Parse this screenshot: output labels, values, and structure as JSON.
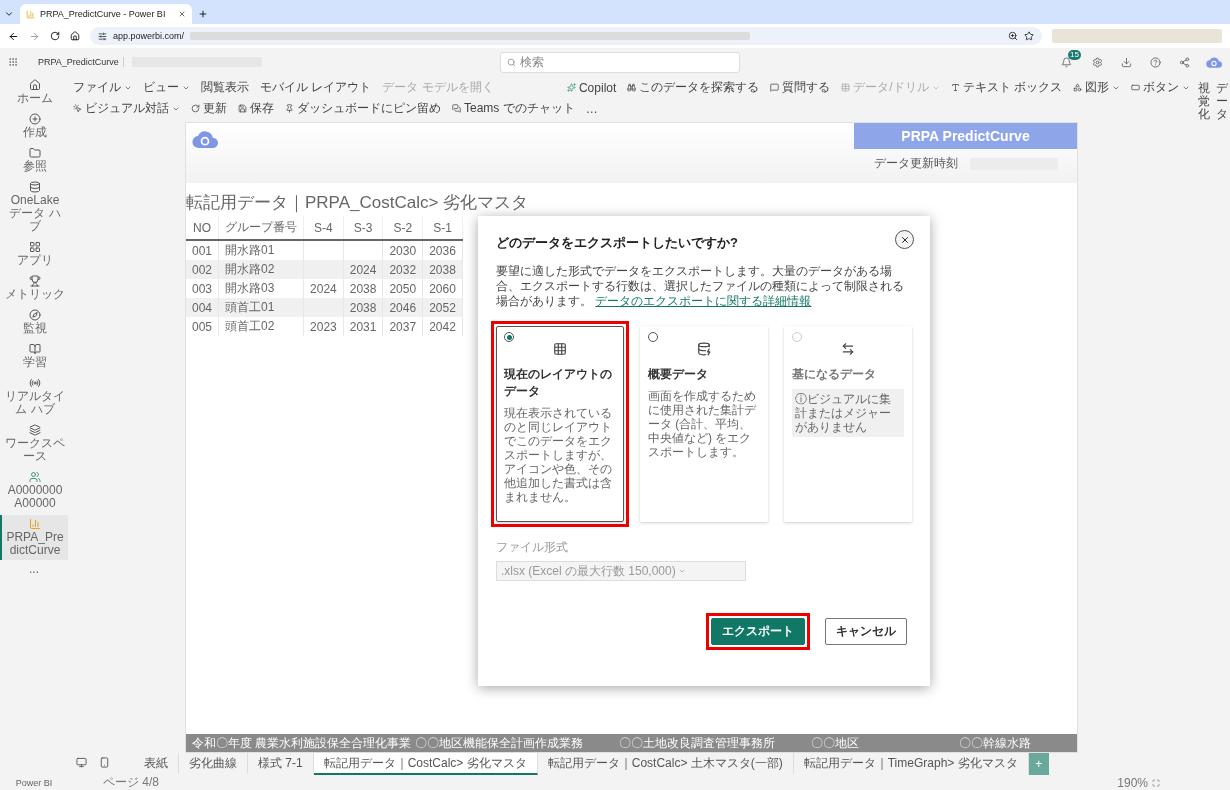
{
  "browser": {
    "tab_title": "PRPA_PredictCurve - Power BI",
    "url": "app.powerbi.com/"
  },
  "header": {
    "breadcrumb": "PRPA_PredictCurve",
    "search": {
      "placeholder": "検索"
    },
    "notification_count": "15"
  },
  "menu_left": [
    {
      "label": "ファイル",
      "dropdown": true,
      "disabled": false
    },
    {
      "label": "ビュー",
      "dropdown": true,
      "disabled": false
    },
    {
      "label": "閲覧表示",
      "dropdown": false,
      "disabled": false
    },
    {
      "label": "モバイル レイアウト",
      "dropdown": false,
      "disabled": false
    },
    {
      "label": "データ モデルを開く",
      "dropdown": false,
      "disabled": true
    }
  ],
  "menu_right": [
    {
      "label": "Copilot",
      "dropdown": false,
      "disabled": false
    },
    {
      "label": "このデータを探索する",
      "dropdown": false,
      "disabled": false
    },
    {
      "label": "質問する",
      "dropdown": false,
      "disabled": false
    },
    {
      "label": "データ/ドリル",
      "dropdown": true,
      "disabled": true
    },
    {
      "label": "テキスト ボックス",
      "dropdown": false,
      "disabled": false
    },
    {
      "label": "図形",
      "dropdown": true,
      "disabled": false
    },
    {
      "label": "ボタン",
      "dropdown": true,
      "disabled": false
    },
    {
      "label": "ビジュアル対話",
      "dropdown": true,
      "disabled": false
    },
    {
      "label": "更新",
      "dropdown": false,
      "disabled": false
    },
    {
      "label": "保存",
      "dropdown": false,
      "disabled": false
    },
    {
      "label": "ダッシュボードにピン留め",
      "dropdown": false,
      "disabled": false
    },
    {
      "label": "Teams でのチャット",
      "dropdown": false,
      "disabled": false
    }
  ],
  "menu_more": "…",
  "sidebar": {
    "items": [
      {
        "label": "ホーム",
        "selected": false
      },
      {
        "label": "作成",
        "selected": false
      },
      {
        "label": "参照",
        "selected": false
      },
      {
        "label": "OneLake データ ハブ",
        "selected": false
      },
      {
        "label": "アプリ",
        "selected": false
      },
      {
        "label": "メトリック",
        "selected": false
      },
      {
        "label": "監視",
        "selected": false
      },
      {
        "label": "学習",
        "selected": false
      },
      {
        "label": "リアルタイム ハブ",
        "selected": false
      },
      {
        "label": "ワークスペース",
        "selected": false
      },
      {
        "label": "A0000000A00000",
        "selected": false
      },
      {
        "label": "PRPA_PredictCurve",
        "selected": true
      }
    ],
    "more": "...",
    "footer": "Power BI"
  },
  "right_panes": [
    "視覚化",
    "データ"
  ],
  "report": {
    "banner_title": "PRPA PredictCurve",
    "update_label": "データ更新時刻",
    "table_title": "転記用データ｜PRPA_CostCalc> 劣化マスタ",
    "table": {
      "columns": [
        "NO",
        "グループ番号",
        "S-4",
        "S-3",
        "S-2",
        "S-1"
      ],
      "rows": [
        [
          "001",
          "開水路01",
          "",
          "",
          "2030",
          "2036"
        ],
        [
          "002",
          "開水路02",
          "",
          "2024",
          "2032",
          "2038"
        ],
        [
          "003",
          "開水路03",
          "2024",
          "2038",
          "2050",
          "2060"
        ],
        [
          "004",
          "頭首工01",
          "",
          "2038",
          "2046",
          "2052"
        ],
        [
          "005",
          "頭首工02",
          "2023",
          "2031",
          "2037",
          "2042"
        ]
      ]
    },
    "footer": [
      "令和〇年度 農業水利施設保全合理化事業 〇〇地区機能保全計画作成業務",
      "〇〇土地改良調査管理事務所",
      "〇〇地区",
      "〇〇幹線水路"
    ]
  },
  "dialog": {
    "title": "どのデータをエクスポートしたいですか?",
    "description": "要望に適した形式でデータをエクスポートします。大量のデータがある場合、エクスポートする行数は、選択したファイルの種類によって制限される場合があります。",
    "link": "データのエクスポートに関する詳細情報",
    "options": [
      {
        "title": "現在のレイアウトのデータ",
        "text": "現在表示されているのと同じレイアウトでこのデータをエクスポートしますが、アイコンや色、その他追加した書式は含まれません。",
        "selected": true,
        "disabled": false,
        "highlighted": true
      },
      {
        "title": "概要データ",
        "text": "画面を作成するために使用された集計データ (合計、平均、中央値など) をエクスポートします。",
        "selected": false,
        "disabled": false,
        "highlighted": false
      },
      {
        "title": "基になるデータ",
        "text": "ⓘビジュアルに集計またはメジャーがありません",
        "selected": false,
        "disabled": true,
        "highlighted": false
      }
    ],
    "format_label": "ファイル形式",
    "format_value": ".xlsx (Excel の最大行数 150,000)",
    "buttons": [
      {
        "label": "エクスポート",
        "kind": "primary",
        "highlighted": true
      },
      {
        "label": "キャンセル",
        "kind": "secondary",
        "highlighted": false
      }
    ]
  },
  "page_tabs": [
    {
      "label": "表紙",
      "selected": false
    },
    {
      "label": "劣化曲線",
      "selected": false
    },
    {
      "label": "様式 7-1",
      "selected": false
    },
    {
      "label": "転記用データ｜CostCalc> 劣化マスタ",
      "selected": true
    },
    {
      "label": "転記用データ｜CostCalc> 土木マスタ(一部)",
      "selected": false
    },
    {
      "label": "転記用データ｜TimeGraph> 劣化マスタ",
      "selected": false
    }
  ],
  "add_page": "+",
  "status": {
    "page": "ページ 4/8",
    "zoom": "190%"
  }
}
